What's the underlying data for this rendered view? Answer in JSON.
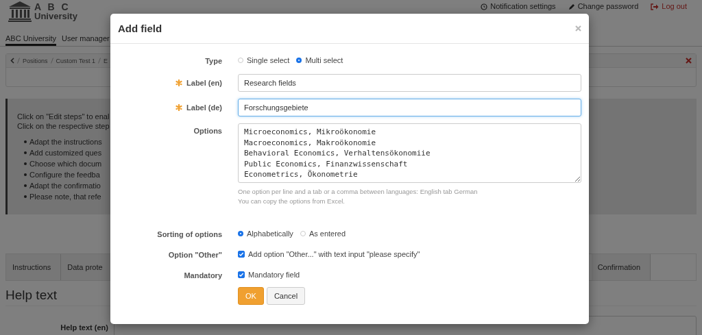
{
  "header": {
    "logo": {
      "line_1": "A B C",
      "line_2": "University"
    },
    "links": [
      {
        "kind": "settings",
        "label": "Notification settings"
      },
      {
        "kind": "password",
        "label": "Change password"
      },
      {
        "kind": "logout",
        "label": "Log out"
      }
    ]
  },
  "nav_tabs": [
    {
      "label": "ABC University",
      "selected": true
    },
    {
      "label": "User manager",
      "selected": false
    }
  ],
  "breadcrumb": [
    "Positions",
    "Custom Test 1",
    "E"
  ],
  "info": {
    "lines": [
      "Click on \"Edit steps\" to enal",
      "Click on the respective step"
    ],
    "bullets": [
      "Adapt the instructions",
      "Add customized ques",
      "Choose which docum",
      "Configure the feedba",
      "Adapt the confirmatio",
      "Please note, that refe"
    ]
  },
  "steps_left": [
    "Instructions",
    "Data prote"
  ],
  "steps_right": [
    "Confirmation"
  ],
  "section": {
    "heading": "Help text",
    "field_label": "Help text (en)"
  },
  "dialog": {
    "title": "Add field",
    "fields": [
      {
        "kind": "radio",
        "label": "Type",
        "options": [
          {
            "label": "Single select",
            "selected": false
          },
          {
            "label": "Multi select",
            "selected": true
          }
        ]
      },
      {
        "kind": "text",
        "label": "Label (en)",
        "required": true,
        "value": "Research fields",
        "focused": false
      },
      {
        "kind": "text",
        "label": "Label (de)",
        "required": true,
        "value": "Forschungsgebiete",
        "focused": true
      },
      {
        "kind": "textarea",
        "label": "Options",
        "value": "Microeconomics, Mikroökonomie\nMacroeconomics, Makroökonomie\nBehavioral Economics, Verhaltensökonomiie\nPublic Economics, Finanzwissenschaft\nEconometrics, Ökonometrie",
        "help": [
          "One option per line and a tab or a comma between languages: English tab German",
          "You can copy the options from Excel."
        ]
      },
      {
        "kind": "radio",
        "label": "Sorting of options",
        "options": [
          {
            "label": "Alphabetically",
            "selected": true
          },
          {
            "label": "As entered",
            "selected": false
          }
        ]
      },
      {
        "kind": "checkbox",
        "label": "Option \"Other\"",
        "text": "Add option \"Other...\" with text input \"please specify\"",
        "checked": true
      },
      {
        "kind": "checkbox",
        "label": "Mandatory",
        "text": "Mandatory field",
        "checked": true
      }
    ],
    "buttons": [
      {
        "kind": "primary",
        "label": "OK"
      },
      {
        "kind": "default",
        "label": "Cancel"
      }
    ]
  }
}
